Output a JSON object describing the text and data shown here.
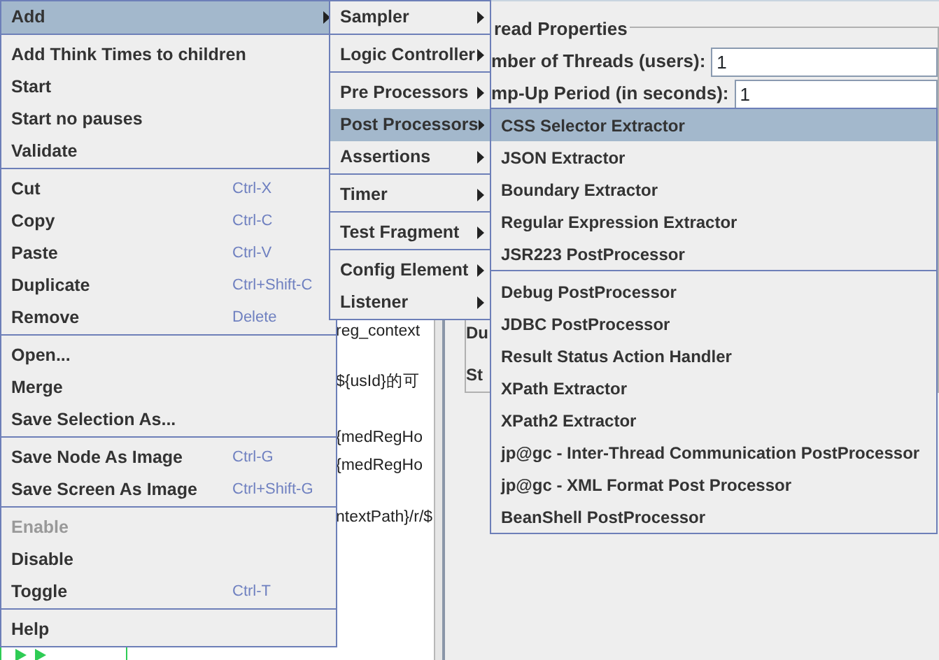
{
  "tree_fragments": [
    "reg_context",
    "${usId}的可",
    "{medRegHo",
    "{medRegHo",
    "ntextPath}/r/$"
  ],
  "thread_properties": {
    "title": "read Properties",
    "fields": [
      {
        "label": "mber of Threads (users):",
        "value": "1"
      },
      {
        "label": "mp-Up Period (in seconds):",
        "value": "1"
      }
    ],
    "cut_labels": [
      "Du",
      "St"
    ]
  },
  "menus": [
    {
      "items": [
        {
          "kind": "item",
          "label": "Add",
          "selected": true,
          "submenu": true
        },
        {
          "kind": "separator"
        },
        {
          "kind": "item",
          "label": "Add Think Times to children",
          "selected": false
        },
        {
          "kind": "item",
          "label": "Start",
          "selected": false
        },
        {
          "kind": "item",
          "label": "Start no pauses",
          "selected": false
        },
        {
          "kind": "item",
          "label": "Validate",
          "selected": false
        },
        {
          "kind": "separator"
        },
        {
          "kind": "item",
          "label": "Cut",
          "shortcut": "Ctrl-X",
          "selected": false
        },
        {
          "kind": "item",
          "label": "Copy",
          "shortcut": "Ctrl-C",
          "selected": false
        },
        {
          "kind": "item",
          "label": "Paste",
          "shortcut": "Ctrl-V",
          "selected": false
        },
        {
          "kind": "item",
          "label": "Duplicate",
          "shortcut": "Ctrl+Shift-C",
          "selected": false
        },
        {
          "kind": "item",
          "label": "Remove",
          "shortcut": "Delete",
          "selected": false
        },
        {
          "kind": "separator"
        },
        {
          "kind": "item",
          "label": "Open...",
          "selected": false
        },
        {
          "kind": "item",
          "label": "Merge",
          "selected": false
        },
        {
          "kind": "item",
          "label": "Save Selection As...",
          "selected": false
        },
        {
          "kind": "separator"
        },
        {
          "kind": "item",
          "label": "Save Node As Image",
          "shortcut": "Ctrl-G",
          "selected": false
        },
        {
          "kind": "item",
          "label": "Save Screen As Image",
          "shortcut": "Ctrl+Shift-G",
          "selected": false
        },
        {
          "kind": "separator"
        },
        {
          "kind": "item",
          "label": "Enable",
          "selected": false,
          "disabled": true
        },
        {
          "kind": "item",
          "label": "Disable",
          "selected": false
        },
        {
          "kind": "item",
          "label": "Toggle",
          "shortcut": "Ctrl-T",
          "selected": false
        },
        {
          "kind": "separator"
        },
        {
          "kind": "item",
          "label": "Help",
          "selected": false
        }
      ]
    },
    {
      "items": [
        {
          "kind": "item",
          "label": "Sampler",
          "selected": false,
          "submenu": true
        },
        {
          "kind": "separator"
        },
        {
          "kind": "item",
          "label": "Logic Controller",
          "selected": false,
          "submenu": true
        },
        {
          "kind": "separator"
        },
        {
          "kind": "item",
          "label": "Pre Processors",
          "selected": false,
          "submenu": true
        },
        {
          "kind": "item",
          "label": "Post Processors",
          "selected": true,
          "submenu": true
        },
        {
          "kind": "item",
          "label": "Assertions",
          "selected": false,
          "submenu": true
        },
        {
          "kind": "separator"
        },
        {
          "kind": "item",
          "label": "Timer",
          "selected": false,
          "submenu": true
        },
        {
          "kind": "separator"
        },
        {
          "kind": "item",
          "label": "Test Fragment",
          "selected": false,
          "submenu": true
        },
        {
          "kind": "separator"
        },
        {
          "kind": "item",
          "label": "Config Element",
          "selected": false,
          "submenu": true
        },
        {
          "kind": "item",
          "label": "Listener",
          "selected": false,
          "submenu": true
        }
      ]
    },
    {
      "items": [
        {
          "kind": "item",
          "label": "CSS Selector Extractor",
          "selected": true
        },
        {
          "kind": "item",
          "label": "JSON Extractor",
          "selected": false
        },
        {
          "kind": "item",
          "label": "Boundary Extractor",
          "selected": false
        },
        {
          "kind": "item",
          "label": "Regular Expression Extractor",
          "selected": false
        },
        {
          "kind": "item",
          "label": "JSR223 PostProcessor",
          "selected": false
        },
        {
          "kind": "separator"
        },
        {
          "kind": "item",
          "label": "Debug PostProcessor",
          "selected": false
        },
        {
          "kind": "item",
          "label": "JDBC PostProcessor",
          "selected": false
        },
        {
          "kind": "item",
          "label": "Result Status Action Handler",
          "selected": false
        },
        {
          "kind": "item",
          "label": "XPath Extractor",
          "selected": false
        },
        {
          "kind": "item",
          "label": "XPath2 Extractor",
          "selected": false
        },
        {
          "kind": "item",
          "label": "jp@gc - Inter-Thread Communication PostProcessor",
          "selected": false
        },
        {
          "kind": "item",
          "label": "jp@gc - XML Format Post Processor",
          "selected": false
        },
        {
          "kind": "item",
          "label": "BeanShell PostProcessor",
          "selected": false
        }
      ]
    }
  ]
}
